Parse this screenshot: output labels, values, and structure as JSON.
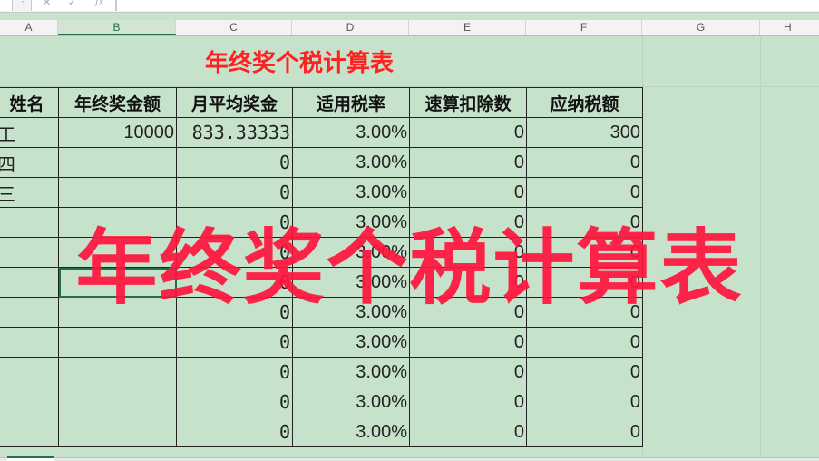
{
  "formula_bar": {
    "separator": "⋮",
    "cancel_icon": "✕",
    "enter_icon": "✓",
    "fx_label": "fx",
    "value": ""
  },
  "columns": [
    "A",
    "B",
    "C",
    "D",
    "E",
    "F",
    "G",
    "H"
  ],
  "selected_column": "B",
  "sheet_title": "年终奖个税计算表",
  "table": {
    "headers": [
      "姓名",
      "年终奖金额",
      "月平均奖金",
      "适用税率",
      "速算扣除数",
      "应纳税额"
    ],
    "rows": [
      [
        "工",
        "10000",
        "833.33333",
        "3.00%",
        "0",
        "300"
      ],
      [
        "四",
        "",
        "0",
        "3.00%",
        "0",
        "0"
      ],
      [
        "三",
        "",
        "0",
        "3.00%",
        "0",
        "0"
      ],
      [
        "",
        "",
        "0",
        "3.00%",
        "0",
        "0"
      ],
      [
        "",
        "",
        "0",
        "3.00%",
        "0",
        "0"
      ],
      [
        "",
        "",
        "0",
        "3.00%",
        "0",
        "0"
      ],
      [
        "",
        "",
        "0",
        "3.00%",
        "0",
        "0"
      ],
      [
        "",
        "",
        "0",
        "3.00%",
        "0",
        "0"
      ],
      [
        "",
        "",
        "0",
        "3.00%",
        "0",
        "0"
      ],
      [
        "",
        "",
        "0",
        "3.00%",
        "0",
        "0"
      ],
      [
        "",
        "",
        "0",
        "3.00%",
        "0",
        "0"
      ]
    ]
  },
  "overlay_title": "年终奖个税计算表",
  "colors": {
    "sheet_background": "#c6e2cb",
    "title_red": "#ff2020",
    "overlay_red": "#ff143c",
    "selection_green": "#217346"
  }
}
